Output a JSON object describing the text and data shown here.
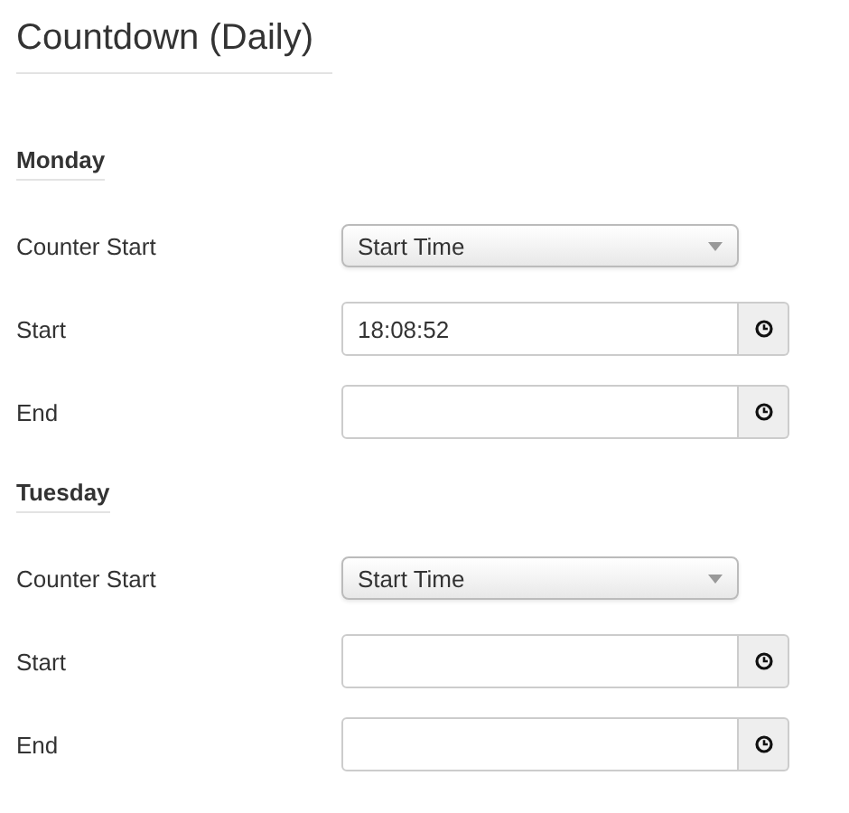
{
  "title": "Countdown (Daily)",
  "days": [
    {
      "name": "Monday",
      "fields": [
        {
          "kind": "select",
          "label": "Counter Start",
          "value": "Start Time"
        },
        {
          "kind": "time",
          "label": "Start",
          "value": "18:08:52"
        },
        {
          "kind": "time",
          "label": "End"
        }
      ]
    },
    {
      "name": "Tuesday",
      "fields": [
        {
          "kind": "select",
          "label": "Counter Start",
          "value": "Start Time"
        },
        {
          "kind": "time",
          "label": "Start"
        },
        {
          "kind": "time",
          "label": "End"
        }
      ]
    }
  ]
}
